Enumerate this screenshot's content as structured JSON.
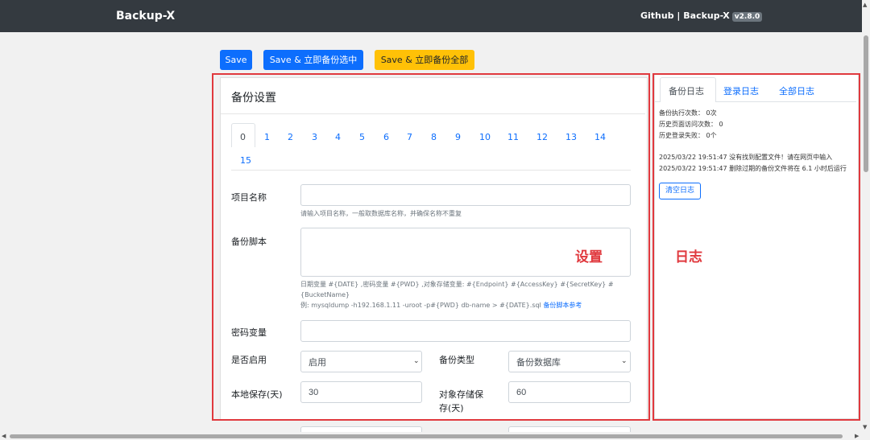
{
  "navbar": {
    "brand": "Backup-X",
    "links": "Github | Backup-X",
    "version": "v2.8.0"
  },
  "toolbar": {
    "save_label": "Save",
    "save_backup_selected_label": "Save & 立即备份选中",
    "save_backup_all_label": "Save & 立即备份全部"
  },
  "settings": {
    "title": "备份设置",
    "tabs": [
      "0",
      "1",
      "2",
      "3",
      "4",
      "5",
      "6",
      "7",
      "8",
      "9",
      "10",
      "11",
      "12",
      "13",
      "14",
      "15"
    ],
    "active_tab": "0",
    "project_name_label": "项目名称",
    "project_name_value": "",
    "project_name_help": "请输入项目名称，一般取数据库名称，并确保名称不重复",
    "script_label": "备份脚本",
    "script_value": "",
    "script_help_1": "日期变量 #{DATE} ,密码变量 #{PWD} ,对象存储变量: #{Endpoint} #{AccessKey} #{SecretKey} #",
    "script_help_2": "{BucketName}",
    "script_help_3": "例: mysqldump -h192.168.1.11 -uroot -p#{PWD} db-name > #{DATE}.sql",
    "script_help_link": "备份脚本参考",
    "password_label": "密码变量",
    "password_value": "",
    "enabled_label": "是否启用",
    "enabled_value": "启用",
    "backup_type_label": "备份类型",
    "backup_type_value": "备份数据库",
    "local_keep_label": "本地保存(天)",
    "local_keep_value": "30",
    "oss_keep_label_1": "对象存储保",
    "oss_keep_label_2": "存(天)",
    "oss_keep_value": "60"
  },
  "annotations": {
    "settings": "设置",
    "logs": "日志"
  },
  "logs": {
    "tabs": [
      "备份日志",
      "登录日志",
      "全部日志"
    ],
    "active_tab": "备份日志",
    "stats": [
      "备份执行次数： 0次",
      "历史页面访问次数： 0",
      "历史登录失败： 0个"
    ],
    "entries": [
      "2025/03/22 19:51:47 没有找到配置文件！请在网页中输入",
      "2025/03/22 19:51:47 删除过期的备份文件将在 6.1 小时后运行"
    ],
    "clear_label": "清空日志"
  },
  "colors": {
    "primary": "#0d6efd",
    "warning": "#ffc107",
    "navbar": "#343a40",
    "annotation": "#e0393e"
  }
}
